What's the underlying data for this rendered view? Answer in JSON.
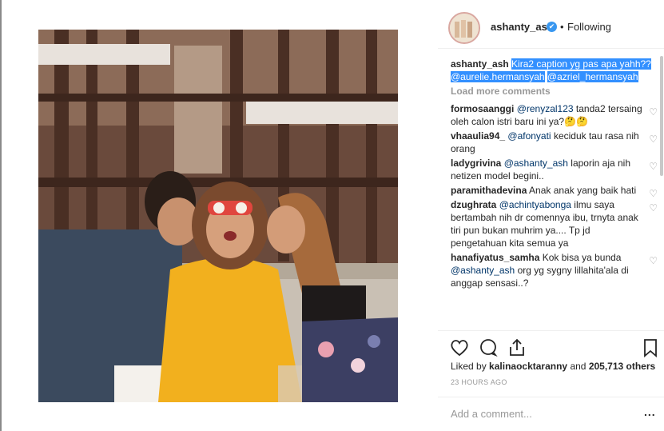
{
  "post": {
    "username": "ashanty_ash",
    "follow_dot": "•",
    "follow_status": "Following",
    "verified_icon": "✔",
    "photo_alt": "photo"
  },
  "caption": {
    "user": "ashanty_ash",
    "text_line": "Kira2 caption yg pas apa yahh??",
    "mention1": "@aurelie.hermansyah",
    "mention2": "@azriel_hermansyah"
  },
  "load_more": "Load more comments",
  "comments": [
    {
      "user": "formosaanggi",
      "mention": "@renyzal123",
      "text": "tanda2 tersaing oleh calon istri baru ini ya?🤔🤔"
    },
    {
      "user": "vhaaulia94_",
      "mention": "@afonyati",
      "text": "keciduk tau rasa nih orang"
    },
    {
      "user": "ladygrivina",
      "mention": "@ashanty_ash",
      "text": "laporin aja nih netizen model begini.."
    },
    {
      "user": "paramithadevina",
      "mention": "",
      "text": "Anak anak yang baik hati"
    },
    {
      "user": "dzughrata",
      "mention": "@achintyabonga",
      "text": "ilmu saya bertambah nih dr comennya ibu, trnyta anak tiri pun bukan muhrim ya.... Tp jd pengetahuan kita semua ya"
    },
    {
      "user": "hanafiyatus_samha",
      "mention": "",
      "text": "Kok bisa ya bunda"
    },
    {
      "user": "",
      "mention": "@ashanty_ash",
      "text": "org yg sygny lillahita'ala di anggap sensasi..?"
    }
  ],
  "likes": {
    "prefix": "Liked by",
    "user": "kalinaocktaranny",
    "middle": "and",
    "count": "205,713 others"
  },
  "timestamp": "23 HOURS AGO",
  "add_comment": {
    "placeholder": "Add a comment...",
    "more": "..."
  },
  "icons": {
    "like": "heart-icon",
    "comment": "comment-icon",
    "share": "share-icon",
    "save": "bookmark-icon"
  }
}
